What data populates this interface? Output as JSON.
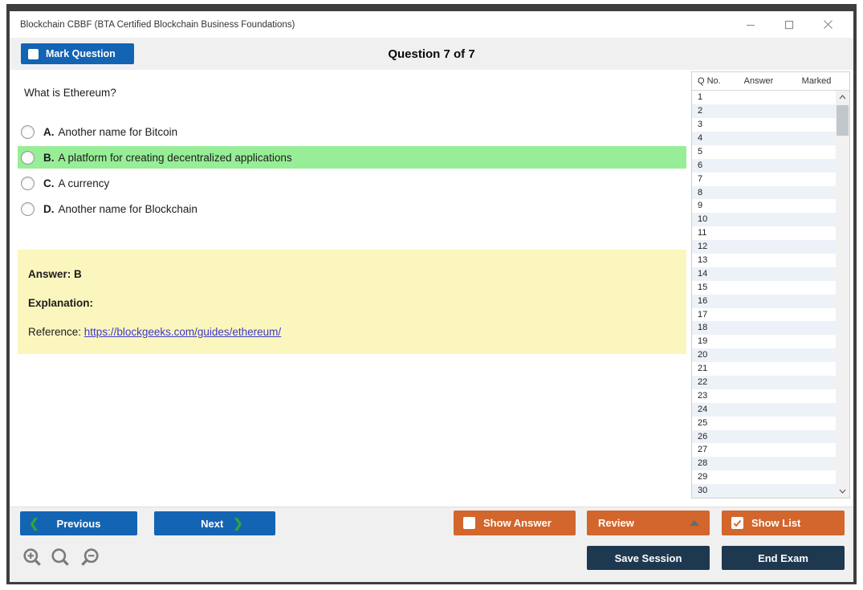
{
  "window": {
    "title": "Blockchain CBBF (BTA Certified Blockchain Business Foundations)"
  },
  "header": {
    "mark_question_label": "Mark Question",
    "question_counter": "Question 7 of 7"
  },
  "question": {
    "text": "What is Ethereum?",
    "options": [
      {
        "letter": "A.",
        "text": "Another name for Bitcoin",
        "highlighted": false
      },
      {
        "letter": "B.",
        "text": "A platform for creating decentralized applications",
        "highlighted": true
      },
      {
        "letter": "C.",
        "text": "A currency",
        "highlighted": false
      },
      {
        "letter": "D.",
        "text": "Another name for Blockchain",
        "highlighted": false
      }
    ]
  },
  "answer_box": {
    "answer_label": "Answer: B",
    "explanation_label": "Explanation:",
    "reference_label": "Reference:",
    "reference_link": "https://blockgeeks.com/guides/ethereum/"
  },
  "question_list": {
    "columns": {
      "c0": "Q No.",
      "c1": "Answer",
      "c2": "Marked"
    },
    "rows": [
      [
        "1",
        "",
        ""
      ],
      [
        "2",
        "",
        ""
      ],
      [
        "3",
        "",
        ""
      ],
      [
        "4",
        "",
        ""
      ],
      [
        "5",
        "",
        ""
      ],
      [
        "6",
        "",
        ""
      ],
      [
        "7",
        "",
        ""
      ],
      [
        "8",
        "",
        ""
      ],
      [
        "9",
        "",
        ""
      ],
      [
        "10",
        "",
        ""
      ],
      [
        "11",
        "",
        ""
      ],
      [
        "12",
        "",
        ""
      ],
      [
        "13",
        "",
        ""
      ],
      [
        "14",
        "",
        ""
      ],
      [
        "15",
        "",
        ""
      ],
      [
        "16",
        "",
        ""
      ],
      [
        "17",
        "",
        ""
      ],
      [
        "18",
        "",
        ""
      ],
      [
        "19",
        "",
        ""
      ],
      [
        "20",
        "",
        ""
      ],
      [
        "21",
        "",
        ""
      ],
      [
        "22",
        "",
        ""
      ],
      [
        "23",
        "",
        ""
      ],
      [
        "24",
        "",
        ""
      ],
      [
        "25",
        "",
        ""
      ],
      [
        "26",
        "",
        ""
      ],
      [
        "27",
        "",
        ""
      ],
      [
        "28",
        "",
        ""
      ],
      [
        "29",
        "",
        ""
      ],
      [
        "30",
        "",
        ""
      ]
    ]
  },
  "footer": {
    "previous_label": "Previous",
    "next_label": "Next",
    "show_answer_label": "Show Answer",
    "review_label": "Review",
    "show_list_label": "Show List",
    "save_session_label": "Save Session",
    "end_exam_label": "End Exam",
    "show_answer_checked": false,
    "show_list_checked": true
  },
  "colors": {
    "primary_blue": "#1464b4",
    "accent_orange": "#d2662c",
    "dark_navy": "#1e3850",
    "highlight_green": "#97ee97",
    "answer_yellow": "#fbf6bd",
    "chevron_green": "#2ca839",
    "link_blue": "#3b37cc",
    "alt_row_blue": "#edf2f8"
  }
}
